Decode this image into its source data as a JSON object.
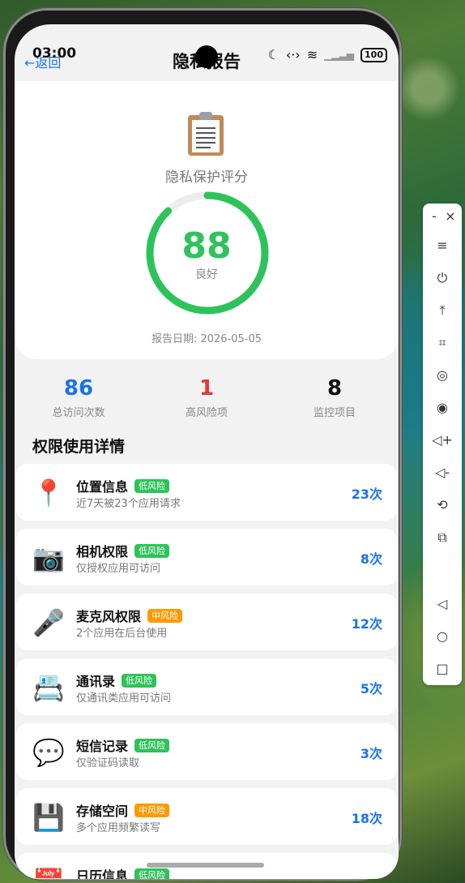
{
  "status": {
    "time": "03:00",
    "battery": "100"
  },
  "nav": {
    "back_label": "返回",
    "title": "隐私报告"
  },
  "score": {
    "label": "隐私保护评分",
    "value": "88",
    "level": "良好",
    "percent": 0.88,
    "report_date": "报告日期: 2026-05-05"
  },
  "stats": [
    {
      "value": "86",
      "label": "总访问次数",
      "color": "#1a73e8"
    },
    {
      "value": "1",
      "label": "高风险项",
      "color": "#e53935"
    },
    {
      "value": "8",
      "label": "监控项目",
      "color": "#111111"
    }
  ],
  "section_title": "权限使用详情",
  "permissions": [
    {
      "icon": "pushpin-icon",
      "glyph": "📍",
      "name": "位置信息",
      "risk": "低风险",
      "risk_level": "low",
      "desc": "近7天被23个应用请求",
      "count": "23次"
    },
    {
      "icon": "camera-icon",
      "glyph": "📷",
      "name": "相机权限",
      "risk": "低风险",
      "risk_level": "low",
      "desc": "仅授权应用可访问",
      "count": "8次"
    },
    {
      "icon": "microphone-icon",
      "glyph": "🎤",
      "name": "麦克风权限",
      "risk": "中风险",
      "risk_level": "mid",
      "desc": "2个应用在后台使用",
      "count": "12次"
    },
    {
      "icon": "contacts-icon",
      "glyph": "📇",
      "name": "通讯录",
      "risk": "低风险",
      "risk_level": "low",
      "desc": "仅通讯类应用可访问",
      "count": "5次"
    },
    {
      "icon": "speech-bubble-icon",
      "glyph": "💬",
      "name": "短信记录",
      "risk": "低风险",
      "risk_level": "low",
      "desc": "仅验证码读取",
      "count": "3次"
    },
    {
      "icon": "floppy-disk-icon",
      "glyph": "💾",
      "name": "存储空间",
      "risk": "中风险",
      "risk_level": "mid",
      "desc": "多个应用频繁读写",
      "count": "18次"
    },
    {
      "icon": "calendar-icon",
      "glyph": "📅",
      "name": "日历信息",
      "risk": "低风险",
      "risk_level": "low",
      "desc": "",
      "count": ""
    }
  ],
  "toolbar": {
    "minimize": "-",
    "close": "×",
    "buttons": [
      {
        "icon": "menu-icon",
        "glyph": "≡"
      },
      {
        "icon": "power-icon",
        "glyph": "⏻"
      },
      {
        "icon": "upload-icon",
        "glyph": "⤒"
      },
      {
        "icon": "crop-icon",
        "glyph": "⌗"
      },
      {
        "icon": "rotate-icon",
        "glyph": "◎"
      },
      {
        "icon": "record-icon",
        "glyph": "◉"
      },
      {
        "icon": "volume-up-icon",
        "glyph": "◁+"
      },
      {
        "icon": "volume-down-icon",
        "glyph": "◁-"
      },
      {
        "icon": "screen-rotate-icon",
        "glyph": "⟲"
      },
      {
        "icon": "multi-window-icon",
        "glyph": "⧉"
      },
      {
        "icon": "back-icon",
        "glyph": "◁"
      },
      {
        "icon": "home-icon",
        "glyph": "○"
      },
      {
        "icon": "recents-icon",
        "glyph": "□"
      }
    ]
  }
}
